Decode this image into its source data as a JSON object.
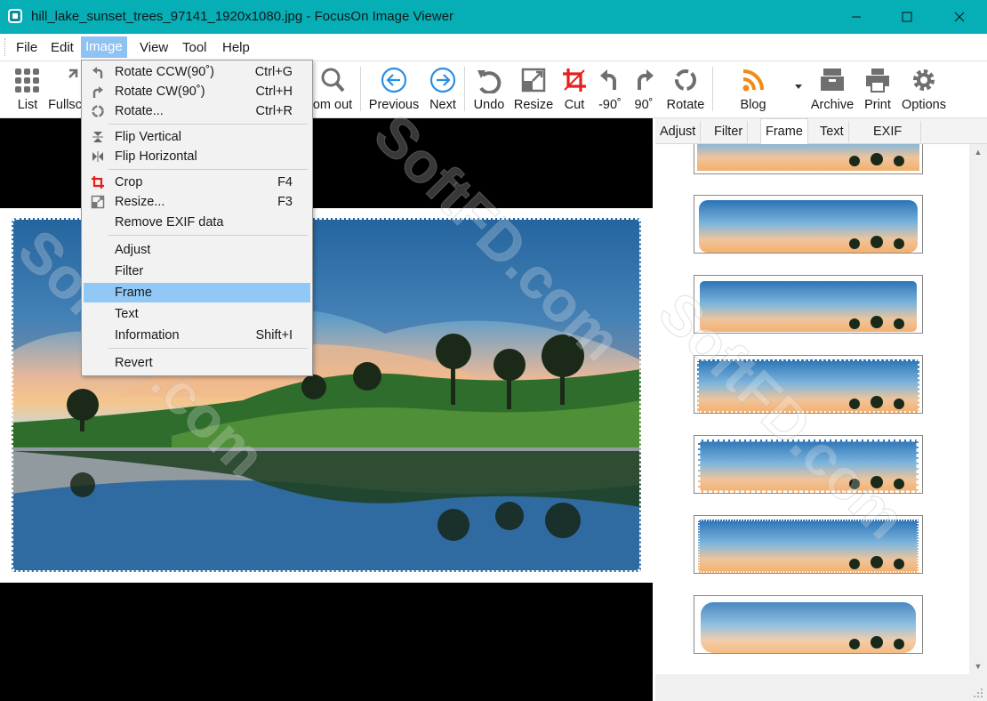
{
  "window": {
    "title": "hill_lake_sunset_trees_97141_1920x1080.jpg - FocusOn Image Viewer",
    "accent_color": "#06aeb6"
  },
  "menubar": {
    "items": [
      "File",
      "Edit",
      "Image",
      "View",
      "Tool",
      "Help"
    ],
    "active": "Image"
  },
  "toolbar": {
    "list": "List",
    "fullscreen": "Fullsc",
    "zoom_out": "om out",
    "previous": "Previous",
    "next": "Next",
    "undo": "Undo",
    "resize": "Resize",
    "cut": "Cut",
    "rotate_left": "-90˚",
    "rotate_right": "90˚",
    "rotate": "Rotate",
    "blog": "Blog",
    "archive": "Archive",
    "print": "Print",
    "options": "Options"
  },
  "image_menu": {
    "items": [
      {
        "label": "Rotate CCW(90˚)",
        "shortcut": "Ctrl+G",
        "icon": "rotate-ccw-icon"
      },
      {
        "label": "Rotate CW(90˚)",
        "shortcut": "Ctrl+H",
        "icon": "rotate-cw-icon"
      },
      {
        "label": "Rotate...",
        "shortcut": "Ctrl+R",
        "icon": "rotate-icon"
      },
      {
        "label": "Flip Vertical",
        "shortcut": "",
        "icon": "flip-vertical-icon"
      },
      {
        "label": "Flip Horizontal",
        "shortcut": "",
        "icon": "flip-horizontal-icon"
      },
      {
        "label": "Crop",
        "shortcut": "F4",
        "icon": "crop-icon"
      },
      {
        "label": "Resize...",
        "shortcut": "F3",
        "icon": "resize-icon"
      },
      {
        "label": "Remove EXIF data",
        "shortcut": ""
      },
      {
        "label": "Adjust",
        "shortcut": ""
      },
      {
        "label": "Filter",
        "shortcut": ""
      },
      {
        "label": "Frame",
        "shortcut": "",
        "highlighted": true
      },
      {
        "label": "Text",
        "shortcut": ""
      },
      {
        "label": "Information",
        "shortcut": "Shift+I"
      },
      {
        "label": "Revert",
        "shortcut": ""
      }
    ]
  },
  "side_panel": {
    "tabs": [
      "Adjust",
      "Filter",
      "Frame",
      "Text",
      "EXIF"
    ],
    "active_tab": "Frame",
    "frame_styles": [
      "frame-1",
      "frame-2",
      "frame-3",
      "frame-4",
      "frame-5",
      "frame-6",
      "frame-7",
      "frame-8"
    ]
  },
  "watermark": "SoftFD.com"
}
